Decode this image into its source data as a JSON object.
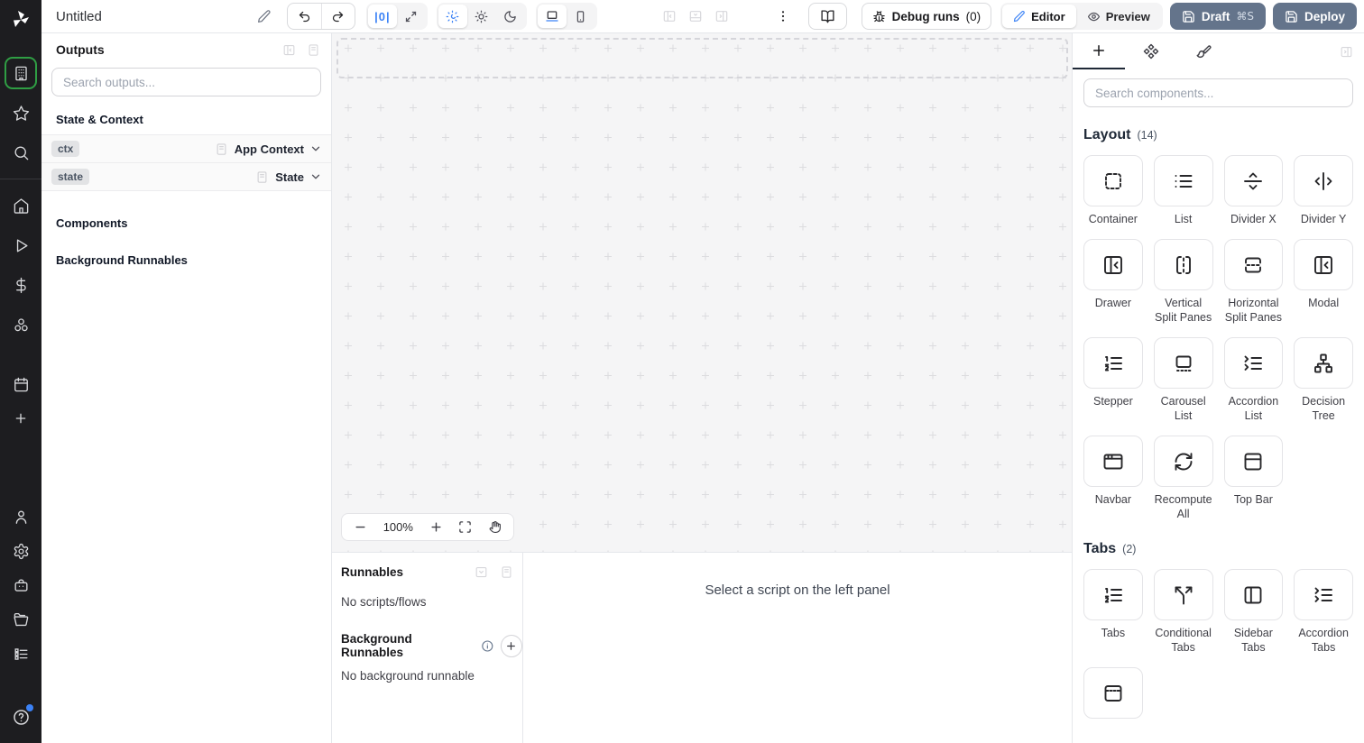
{
  "topbar": {
    "title": "Untitled",
    "zoom_reset_label": "|0|",
    "debug_runs_label": "Debug runs",
    "debug_runs_count": "(0)",
    "editor_label": "Editor",
    "preview_label": "Preview",
    "draft_label": "Draft",
    "draft_shortcut": "⌘S",
    "deploy_label": "Deploy",
    "colors": {
      "accent_blue": "#3b82f6",
      "slate_button": "#64748b",
      "active_green_ring": "#2f9e44"
    }
  },
  "outputs_panel": {
    "title": "Outputs",
    "search_placeholder": "Search outputs...",
    "state_context_header": "State & Context",
    "components_header": "Components",
    "background_runnables_header": "Background Runnables",
    "rows": [
      {
        "badge": "ctx",
        "type": "App Context",
        "doc_icon": "document-icon",
        "chevron_icon": "chevron-down-icon"
      },
      {
        "badge": "state",
        "type": "State",
        "doc_icon": "document-icon",
        "chevron_icon": "chevron-down-icon"
      }
    ]
  },
  "canvas": {
    "zoom_level": "100%",
    "controls": [
      "zoom-out-icon",
      "zoom-level",
      "zoom-in-icon",
      "fit-view-icon",
      "pan-hand-icon"
    ]
  },
  "runnables_panel": {
    "title": "Runnables",
    "empty_text": "No scripts/flows",
    "background_title": "Background Runnables",
    "background_empty_text": "No background runnable"
  },
  "script_panel": {
    "placeholder": "Select a script on the left panel"
  },
  "components_panel": {
    "search_placeholder": "Search components...",
    "tabs": [
      "plus-icon",
      "components-icon",
      "paintbrush-icon"
    ],
    "sections": [
      {
        "title": "Layout",
        "count": "(14)",
        "items": [
          {
            "label": "Container",
            "icon": "container-icon"
          },
          {
            "label": "List",
            "icon": "list-icon"
          },
          {
            "label": "Divider X",
            "icon": "divider-x-icon"
          },
          {
            "label": "Divider Y",
            "icon": "divider-y-icon"
          },
          {
            "label": "Drawer",
            "icon": "drawer-icon"
          },
          {
            "label": "Vertical Split Panes",
            "icon": "vertical-split-icon"
          },
          {
            "label": "Horizontal Split Panes",
            "icon": "horizontal-split-icon"
          },
          {
            "label": "Modal",
            "icon": "modal-icon"
          },
          {
            "label": "Stepper",
            "icon": "stepper-icon"
          },
          {
            "label": "Carousel List",
            "icon": "carousel-icon"
          },
          {
            "label": "Accordion List",
            "icon": "accordion-list-icon"
          },
          {
            "label": "Decision Tree",
            "icon": "decision-tree-icon"
          },
          {
            "label": "Navbar",
            "icon": "navbar-icon"
          },
          {
            "label": "Recompute All",
            "icon": "recompute-icon"
          },
          {
            "label": "Top Bar",
            "icon": "top-bar-icon"
          }
        ]
      },
      {
        "title": "Tabs",
        "count": "(2)",
        "items": [
          {
            "label": "Tabs",
            "icon": "tabs-icon"
          },
          {
            "label": "Conditional Tabs",
            "icon": "conditional-tabs-icon"
          },
          {
            "label": "Sidebar Tabs",
            "icon": "sidebar-tabs-icon"
          },
          {
            "label": "Accordion Tabs",
            "icon": "accordion-tabs-icon"
          },
          {
            "label": "",
            "icon": "window-tabs-icon"
          }
        ]
      }
    ]
  }
}
